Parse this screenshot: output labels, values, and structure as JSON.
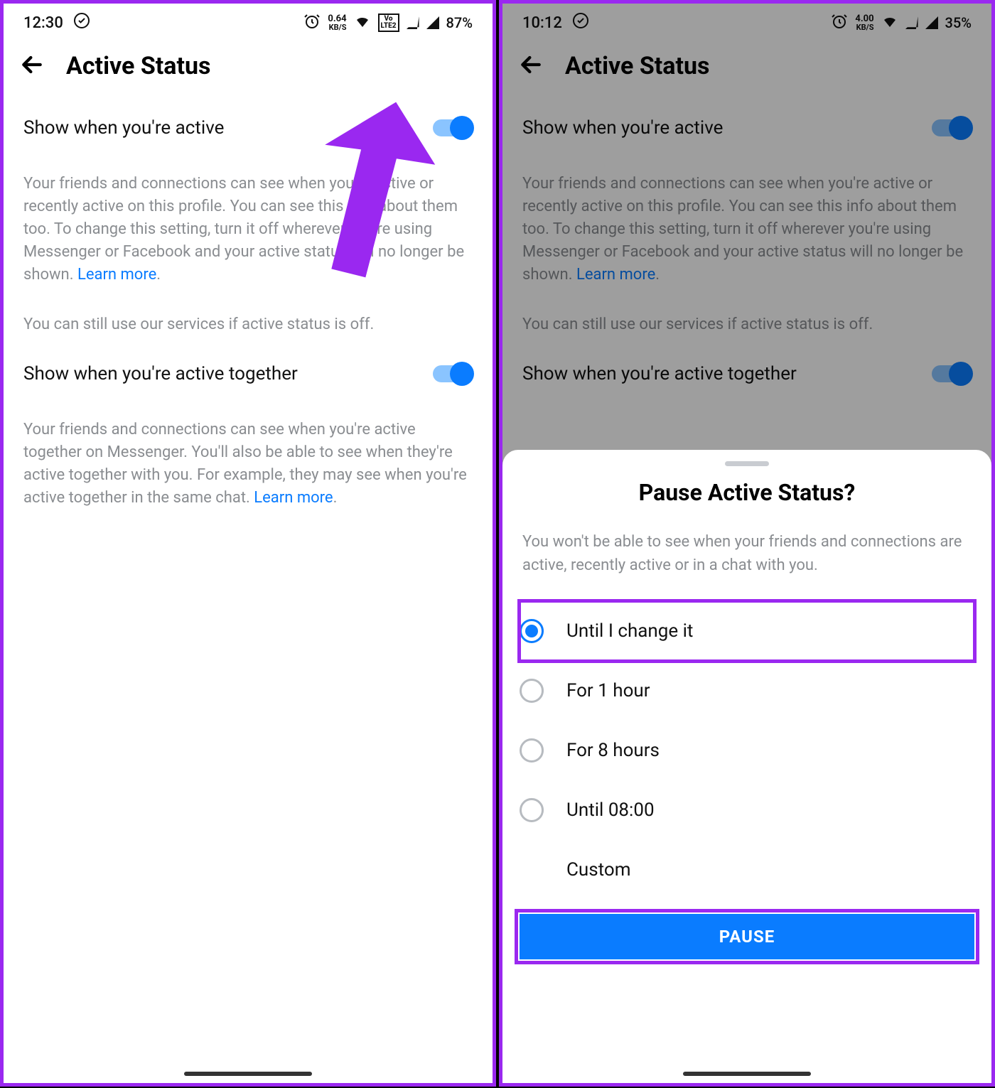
{
  "left": {
    "status": {
      "time": "12:30",
      "kbs_top": "0.64",
      "kbs_bot": "KB/S",
      "lte": "LTE2",
      "battery": "87%"
    },
    "header": {
      "title": "Active Status"
    },
    "row1": {
      "label": "Show when you're active"
    },
    "desc1": {
      "text": "Your friends and connections can see when you're active or recently active on this profile. You can see this info about them too. To change this setting, turn it off wherever you're using Messenger or Facebook and your active status will no longer be shown. ",
      "link": "Learn more"
    },
    "note": "You can still use our services if active status is off.",
    "row2": {
      "label": "Show when you're active together"
    },
    "desc2": {
      "text": "Your friends and connections can see when you're active together on Messenger. You'll also be able to see when they're active together with you. For example, they may see when you're active together in the same chat. ",
      "link": "Learn more"
    }
  },
  "right": {
    "status": {
      "time": "10:12",
      "kbs_top": "4.00",
      "kbs_bot": "KB/S",
      "battery": "35%"
    },
    "header": {
      "title": "Active Status"
    },
    "row1": {
      "label": "Show when you're active"
    },
    "desc1": {
      "text": "Your friends and connections can see when you're active or recently active on this profile. You can see this info about them too. To change this setting, turn it off wherever you're using Messenger or Facebook and your active status will no longer be shown. ",
      "link": "Learn more"
    },
    "note": "You can still use our services if active status is off.",
    "row2": {
      "label": "Show when you're active together"
    },
    "sheet": {
      "title": "Pause Active Status?",
      "desc": "You won't be able to see when your friends and connections are active, recently active or in a chat with you.",
      "options": [
        {
          "label": "Until I change it",
          "selected": true
        },
        {
          "label": "For 1 hour",
          "selected": false
        },
        {
          "label": "For 8 hours",
          "selected": false
        },
        {
          "label": "Until 08:00",
          "selected": false
        },
        {
          "label": "Custom",
          "selected": false,
          "noRadio": true
        }
      ],
      "button": "PAUSE"
    }
  }
}
